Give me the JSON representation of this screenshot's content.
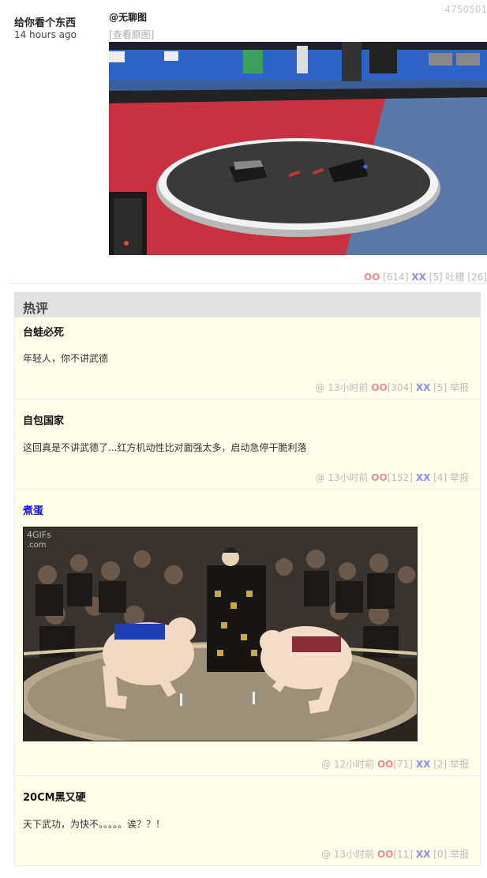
{
  "post": {
    "id": "4750501",
    "author": "给你看个东西",
    "time": "14 hours ago",
    "mention": "@无聊图",
    "view_original": "[查看原图]",
    "votes": {
      "oo_label": "OO",
      "oo": "[614]",
      "xx_label": "XX",
      "xx": "[5]",
      "tucao_label": "吐槽",
      "tucao": "[26]"
    }
  },
  "hot": {
    "title": "热评",
    "comments": [
      {
        "author": "台蛙必死",
        "text": "年轻人，你不讲武德",
        "at": "@",
        "time": "13小时前",
        "oo_label": "OO",
        "oo": "[304]",
        "xx_label": "XX",
        "xx": "[5]",
        "report": "举报"
      },
      {
        "author": "自包国家",
        "text": "这回真是不讲武德了...红方机动性比对面强太多，启动急停干脆利落",
        "at": "@",
        "time": "13小时前",
        "oo_label": "OO",
        "oo": "[152]",
        "xx_label": "XX",
        "xx": "[4]",
        "report": "举报"
      },
      {
        "author": "煮蛋",
        "gif_watermark": "4GIFs\n.com",
        "at": "@",
        "time": "12小时前",
        "oo_label": "OO",
        "oo": "[71]",
        "xx_label": "XX",
        "xx": "[2]",
        "report": "举报"
      },
      {
        "author": "20CM黑又硬",
        "text": "天下武功，为快不。。。。。诶？？！",
        "at": "@",
        "time": "13小时前",
        "oo_label": "OO",
        "oo": "[11]",
        "xx_label": "XX",
        "xx": "[0]",
        "report": "举报"
      }
    ]
  }
}
